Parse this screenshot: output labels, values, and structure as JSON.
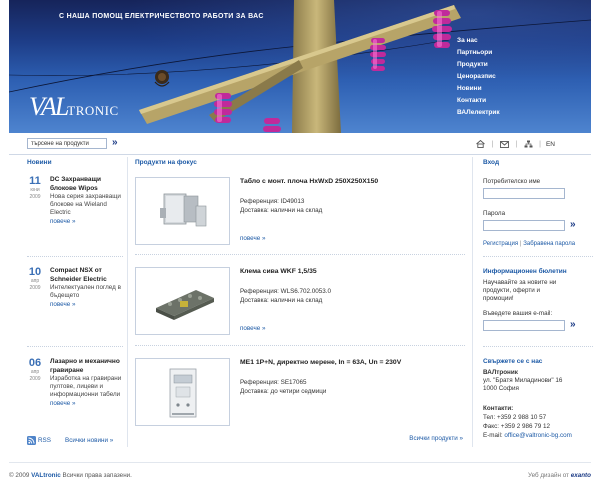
{
  "header": {
    "tagline": "С НАША ПОМОЩ ЕЛЕКТРИЧЕСТВОТО РАБОТИ ЗА ВАС",
    "logo_mark": "VAL",
    "logo_text": "TRONIC",
    "nav": [
      "За нас",
      "Партньори",
      "Продукти",
      "Ценоразпис",
      "Новини",
      "Контакти",
      "ВАЛелектрик"
    ]
  },
  "toolbar": {
    "search_value": "търсене на продукти",
    "search_go": "»",
    "icons": [
      "home-icon",
      "mail-icon",
      "sitemap-icon"
    ],
    "lang": "EN"
  },
  "news": {
    "title": "Новини",
    "items": [
      {
        "day": "11",
        "month": "юни",
        "year": "2009",
        "title": "DC Захранващи блокове Wipos",
        "desc": "Нова серия захранващи блокове на Wieland Electric",
        "more": "повече »"
      },
      {
        "day": "10",
        "month": "апр",
        "year": "2009",
        "title": "Compact NSX от Schneider Electric",
        "desc": "Интелектуален поглед в бъдещето",
        "more": "повече »"
      },
      {
        "day": "06",
        "month": "апр",
        "year": "2009",
        "title": "Лазарно и механично гравиране",
        "desc": "Изработка на гравирани пултове, лицеви и информационни табели",
        "more": "повече »"
      }
    ],
    "rss": "RSS",
    "all_news": "Всички новини »"
  },
  "products": {
    "title": "Продукти на фокус",
    "items": [
      {
        "name": "Табло с монт. плоча HxWxD 250X250X150",
        "ref": "Референция: ID49013",
        "delivery": "Доставка: налични на склад",
        "more": "повече »"
      },
      {
        "name": "Клема сива WKF 1,5/35",
        "ref": "Референция: WLS6.702.0053.0",
        "delivery": "Доставка: налични на склад",
        "more": "повече »"
      },
      {
        "name": "МЕ1 1Р+N, директно мерене, In = 63A, Un = 230V",
        "ref": "Референция: SE17065",
        "delivery": "Доставка: до четири седмици",
        "more": "повече »"
      }
    ],
    "all_products": "Всички продукти »"
  },
  "login": {
    "title": "Вход",
    "username_label": "Потребителско име",
    "password_label": "Парола",
    "go": "»",
    "register": "Регистрация",
    "forgot": "Забравена парола"
  },
  "newsletter": {
    "title": "Информационен бюлетин",
    "text": "Научавайте за новите ни продукти, оферти и промоции!",
    "email_label": "Въведете вашия e-mail:",
    "go": "»"
  },
  "contact": {
    "title": "Свържете се с нас",
    "company": "ВАЛтроник",
    "address1": "ул. \"Братя Миладинови\" 16",
    "address2": "1000 София",
    "contacts_title": "Контакти:",
    "phone": "Тел: +359 2 988 10 57",
    "fax": "Факс: +359 2 986 79 12",
    "email_label": "E-mail:",
    "email": "office@valtronic-bg.com"
  },
  "footer": {
    "copyright": "© 2009",
    "brand": "VALtronic",
    "rights": "Всички права запазени.",
    "credit": "Уеб дизайн от",
    "studio": "exanto"
  }
}
